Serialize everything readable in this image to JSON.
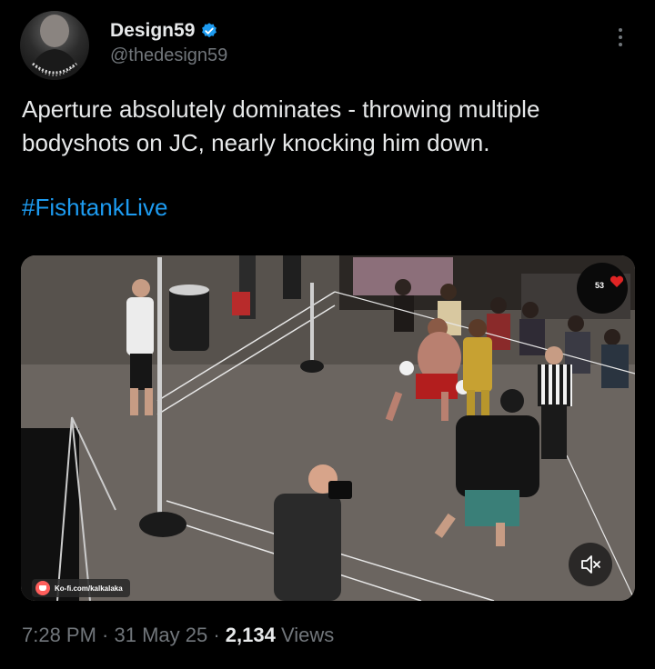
{
  "author": {
    "display_name": "Design59",
    "handle": "@thedesign59",
    "verified": true,
    "avatar_icon": "avatar-image"
  },
  "tweet": {
    "text": "Aperture absolutely dominates - throwing multiple bodyshots on JC, nearly knocking him down.",
    "hashtag": "#FishtankLive"
  },
  "media": {
    "type": "video",
    "overlay_badge": "53",
    "watermark": "Ko-fi.com/kalkalaka",
    "mute_icon": "speaker-muted-icon"
  },
  "meta": {
    "time": "7:28 PM",
    "separator": " · ",
    "date": "31 May 25",
    "views_count": "2,134",
    "views_label": " Views"
  },
  "colors": {
    "background": "#000000",
    "primary_text": "#e7e9ea",
    "secondary_text": "#71767b",
    "link": "#1d9bf0",
    "verified": "#1d9bf0"
  }
}
